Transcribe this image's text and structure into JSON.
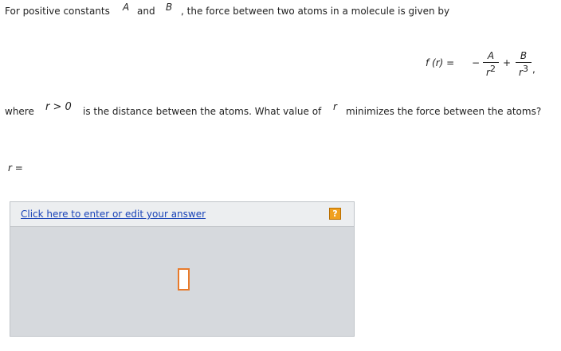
{
  "problem": {
    "line1": {
      "pre": "For positive constants",
      "var_a": "A",
      "and": "and",
      "var_b": "B",
      "post": ", the force between two atoms in a molecule is given by"
    },
    "formula": {
      "lhs": "f (r) =",
      "minus": "−",
      "frac1_num": "A",
      "frac1_den": "r",
      "frac1_exp": "2",
      "plus": "+",
      "frac2_num": "B",
      "frac2_den": "r",
      "frac2_exp": "3",
      "trail": ","
    },
    "line2": {
      "pre": "where",
      "condition": "r > 0",
      "mid": "is the distance between the atoms. What value of",
      "var_r": "r",
      "post": "minimizes the force between the atoms?"
    },
    "answer_label": "r ="
  },
  "answer_panel": {
    "link_text": "Click here to enter or edit your answer",
    "help_label": "?"
  }
}
